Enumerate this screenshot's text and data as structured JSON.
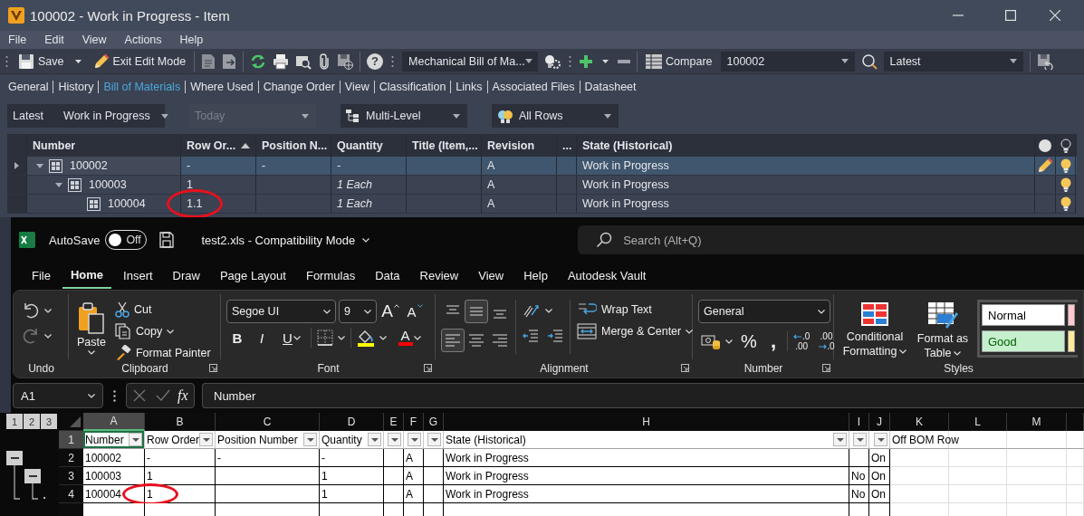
{
  "vault": {
    "title": "100002 - Work in Progress - Item",
    "menu": [
      "File",
      "Edit",
      "View",
      "Actions",
      "Help"
    ],
    "toolbar": {
      "save": "Save",
      "exit_edit": "Exit Edit Mode",
      "help_glyph": "?",
      "bom_view": "Mechanical Bill of Ma...",
      "compare": "Compare",
      "compare_item": "100002",
      "version": "Latest"
    },
    "tabs": [
      {
        "label": "General",
        "selected": false
      },
      {
        "label": "History",
        "selected": false
      },
      {
        "label": "Bill of Materials",
        "selected": true
      },
      {
        "label": "Where Used",
        "selected": false
      },
      {
        "label": "Change Order",
        "selected": false
      },
      {
        "label": "View",
        "selected": false
      },
      {
        "label": "Classification",
        "selected": false
      },
      {
        "label": "Links",
        "selected": false
      },
      {
        "label": "Associated Files",
        "selected": false
      },
      {
        "label": "Datasheet",
        "selected": false
      }
    ],
    "filters": [
      {
        "kind": "revision",
        "label": "Latest",
        "value": "Work in Progress",
        "disabled": false
      },
      {
        "kind": "date",
        "value": "Today",
        "disabled": true
      },
      {
        "kind": "levels",
        "value": "Multi-Level",
        "disabled": false
      },
      {
        "kind": "rows",
        "value": "All Rows",
        "disabled": false
      }
    ],
    "bom": {
      "columns": [
        {
          "label": "Number",
          "sorted": false
        },
        {
          "label": "Row Or...",
          "sorted": true
        },
        {
          "label": "Position N...",
          "sorted": false
        },
        {
          "label": "Quantity",
          "sorted": false
        },
        {
          "label": "Title (Item,...",
          "sorted": false
        },
        {
          "label": "Revision",
          "sorted": false
        },
        {
          "label": "...",
          "sorted": false
        },
        {
          "label": "State (Historical)",
          "sorted": false
        }
      ],
      "rows": [
        {
          "number": "100002",
          "row_order": "-",
          "position_number": "-",
          "quantity": "-",
          "revision": "A",
          "state": "Work in Progress",
          "selected": true,
          "editing": true,
          "circled": false,
          "expanded": true,
          "children": [
            {
              "number": "100003",
              "row_order": "1",
              "quantity": "1 Each",
              "revision": "A",
              "state": "Work in Progress",
              "selected": false,
              "editing": false,
              "circled": false,
              "expanded": true,
              "children": [
                {
                  "number": "100004",
                  "row_order": "1.1",
                  "quantity": "1 Each",
                  "revision": "A",
                  "state": "Work in Progress",
                  "selected": false,
                  "editing": false,
                  "circled": true
                }
              ]
            }
          ]
        }
      ]
    }
  },
  "excel": {
    "autosave": {
      "label": "AutoSave",
      "on": false,
      "state_text": "Off"
    },
    "document_title": "test2.xls - Compatibility Mode",
    "search_placeholder": "Search (Alt+Q)",
    "tabs": [
      {
        "label": "File",
        "selected": false
      },
      {
        "label": "Home",
        "selected": true
      },
      {
        "label": "Insert",
        "selected": false
      },
      {
        "label": "Draw",
        "selected": false
      },
      {
        "label": "Page Layout",
        "selected": false
      },
      {
        "label": "Formulas",
        "selected": false
      },
      {
        "label": "Data",
        "selected": false
      },
      {
        "label": "Review",
        "selected": false
      },
      {
        "label": "View",
        "selected": false
      },
      {
        "label": "Help",
        "selected": false
      },
      {
        "label": "Autodesk Vault",
        "selected": false
      }
    ],
    "ribbon": {
      "undo": {
        "label": "Undo"
      },
      "clipboard": {
        "paste": "Paste",
        "cut": "Cut",
        "copy": "Copy",
        "format_painter": "Format Painter",
        "label": "Clipboard"
      },
      "font": {
        "name": "Segoe UI",
        "size": "9",
        "grow_glyph": "A",
        "shrink_glyph": "A",
        "bold_glyph": "B",
        "italic_glyph": "I",
        "underline_glyph": "U",
        "color_glyph": "A",
        "label": "Font"
      },
      "alignment": {
        "vertical": [
          {
            "selected": false
          },
          {
            "selected": true
          },
          {
            "selected": false
          }
        ],
        "horizontal": [
          {
            "selected": true
          },
          {
            "selected": false
          },
          {
            "selected": false
          }
        ],
        "wrap": "Wrap Text",
        "merge": "Merge & Center",
        "label": "Alignment"
      },
      "number": {
        "format": "General",
        "percent_glyph": "%",
        "comma_glyph": ",",
        "decimals": [
          {
            "top": ".0",
            "bottom": ".00"
          },
          {
            "top": ".00",
            "bottom": ".0"
          }
        ],
        "label": "Number"
      },
      "styles": {
        "conditional": "Conditional Formatting",
        "table": "Format as Table",
        "label": "Styles",
        "cell_styles": [
          {
            "label": "Normal",
            "color": "#ffffff"
          },
          {
            "label": "Good",
            "color": "#c6efce"
          },
          {
            "color": "#ffc7ce"
          },
          {
            "color": "#ffeb9c"
          }
        ]
      }
    },
    "name_box": "A1",
    "function_glyph": "fx",
    "formula": "Number",
    "outline_levels": [
      "1",
      "2",
      "3"
    ],
    "sheet": {
      "columns": [
        {
          "letter": "A",
          "selected": true
        },
        {
          "letter": "B",
          "selected": false
        },
        {
          "letter": "C",
          "selected": false
        },
        {
          "letter": "D",
          "selected": false
        },
        {
          "letter": "E",
          "selected": false
        },
        {
          "letter": "F",
          "selected": false
        },
        {
          "letter": "G",
          "selected": false
        },
        {
          "letter": "H",
          "selected": false
        },
        {
          "letter": "I",
          "selected": false
        },
        {
          "letter": "J",
          "selected": false
        },
        {
          "letter": "K",
          "selected": false
        },
        {
          "letter": "L",
          "selected": false
        },
        {
          "letter": "M",
          "selected": false
        }
      ],
      "header_row": {
        "number": "1",
        "selected": true,
        "cells": [
          {
            "text": "Number",
            "filter": true
          },
          {
            "text": "Row Order",
            "filter": true
          },
          {
            "text": "Position Number",
            "filter": true
          },
          {
            "text": "Quantity",
            "filter": true
          },
          {
            "filter": true
          },
          {
            "filter": true
          },
          {
            "filter": true
          },
          {
            "text": "State (Historical)",
            "filter": true
          },
          {
            "filter": true
          },
          {
            "filter": true
          },
          {
            "text": "Off BOM Row",
            "filter": false
          },
          {
            "filter": false
          },
          {
            "filter": false
          }
        ]
      },
      "rows": [
        {
          "number": "2",
          "selected": false,
          "kind": "button",
          "collapsed": false,
          "circled": false,
          "cells": {
            "A": "100002",
            "B": "-",
            "C": "-",
            "D": "-",
            "F": "A",
            "H": "Work in Progress",
            "J": "On"
          }
        },
        {
          "number": "3",
          "selected": false,
          "kind": "button",
          "collapsed": false,
          "circled": false,
          "cells": {
            "A": "100003",
            "B": "1",
            "D": "1",
            "F": "A",
            "H": "Work in Progress",
            "I": "No",
            "J": "On"
          }
        },
        {
          "number": "4",
          "selected": false,
          "kind": "dot",
          "circled": true,
          "cells": {
            "A": "100004",
            "B": "1",
            "D": "1",
            "F": "A",
            "H": "Work in Progress",
            "I": "No",
            "J": "On"
          }
        }
      ]
    }
  }
}
